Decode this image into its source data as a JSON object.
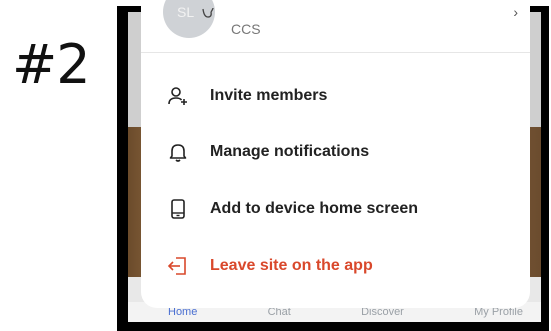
{
  "step_label": "#2",
  "site": {
    "avatar_initials": "SL",
    "name": "CCS"
  },
  "menu": {
    "items": [
      {
        "label": "Invite members",
        "icon": "add-person-icon"
      },
      {
        "label": "Manage notifications",
        "icon": "bell-icon"
      },
      {
        "label": "Add to device home screen",
        "icon": "phone-icon"
      },
      {
        "label": "Leave site on the app",
        "icon": "leave-icon",
        "color": "#d9482b"
      }
    ]
  },
  "bottom_nav": {
    "tabs": [
      "Home",
      "Chat",
      "Discover",
      "My Profile"
    ]
  }
}
